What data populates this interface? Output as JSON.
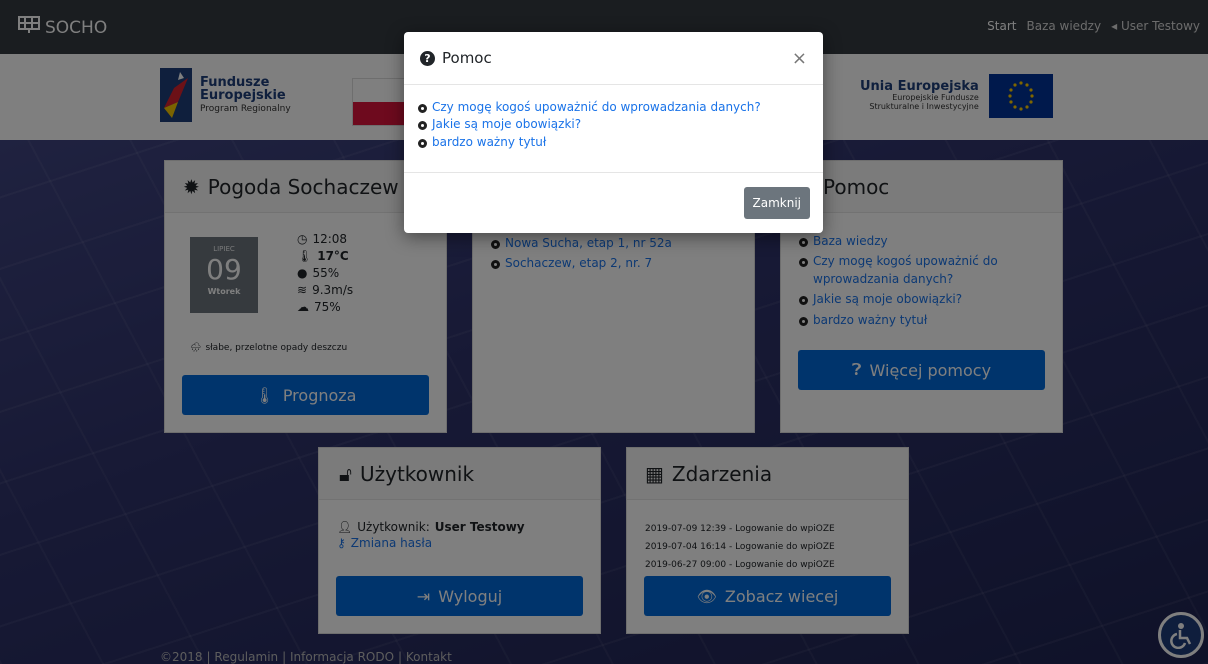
{
  "navbar": {
    "brand": "SOCHO",
    "links": {
      "start": "Start",
      "knowledge": "Baza wiedzy",
      "user": "User Testowy"
    }
  },
  "eu_bar": {
    "fe_line1": "Fundusze",
    "fe_line2": "Europejskie",
    "fe_line3": "Program Regionalny",
    "ue_line1": "Unia Europejska",
    "ue_line2": "Europejskie Fundusze",
    "ue_line3": "Strukturalne i Inwestycyjne"
  },
  "weather": {
    "title": "Pogoda Sochaczew",
    "month": "LIPIEC",
    "day": "09",
    "weekday": "Wtorek",
    "time": "12:08",
    "temp": "17°C",
    "humidity": "55%",
    "wind": "9.3m/s",
    "clouds": "75%",
    "description": "słabe, przelotne opady deszczu",
    "forecast_button": "Prognoza"
  },
  "installations": {
    "items": [
      "Nowa Sucha, etap 1, nr 52a",
      "Sochaczew, etap 2, nr. 7"
    ]
  },
  "help_card": {
    "title": "Pomoc",
    "items": [
      "Baza wiedzy",
      "Czy mogę kogoś upoważnić do wprowadzania danych?",
      "Jakie są moje obowiązki?",
      "bardzo ważny tytuł"
    ],
    "more_button": "Więcej pomocy"
  },
  "user_card": {
    "title": "Użytkownik",
    "user_label": "Użytkownik:",
    "user_name": "User Testowy",
    "change_password": "Zmiana hasła",
    "logout_button": "Wyloguj"
  },
  "events": {
    "title": "Zdarzenia",
    "items": [
      "2019-07-09 12:39 - Logowanie do wpiOZE",
      "2019-07-04 16:14 - Logowanie do wpiOZE",
      "2019-06-27 09:00 - Logowanie do wpiOZE"
    ],
    "more_button": "Zobacz wiecej"
  },
  "footer": {
    "copyright": "©2018",
    "terms": "Regulamin",
    "rodo": "Informacja RODO",
    "contact": "Kontakt"
  },
  "modal": {
    "title": "Pomoc",
    "close": "×",
    "links": [
      "Czy mogę kogoś upoważnić do wprowadzania danych?",
      "Jakie są moje obowiązki?",
      "bardzo ważny tytuł"
    ],
    "close_button": "Zamknij"
  },
  "colors": {
    "primary": "#0069d9",
    "navbar": "#343a40",
    "secondary": "#6c757d",
    "link": "#1a73e8"
  }
}
